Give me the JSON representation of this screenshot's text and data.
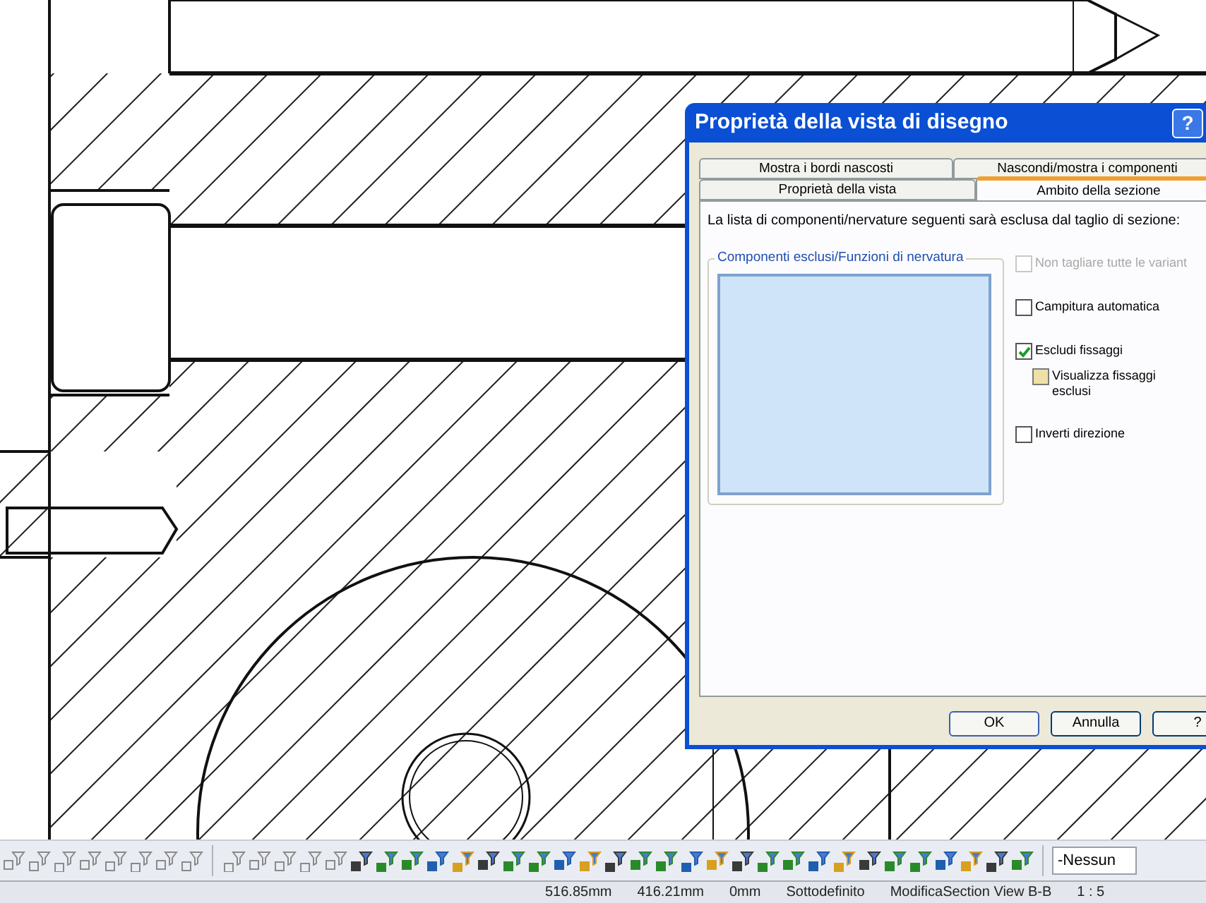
{
  "dialog": {
    "title": "Proprietà della vista di disegno",
    "help_button": "?",
    "tabs_back_row": [
      {
        "label": "Mostra i bordi nascosti",
        "selected": false
      },
      {
        "label": "Nascondi/mostra i componenti",
        "selected": false
      }
    ],
    "tabs_front_row": [
      {
        "label": "Proprietà della vista",
        "selected": false
      },
      {
        "label": "Ambito della sezione",
        "selected": true
      }
    ],
    "description": "La lista di componenti/nervature seguenti sarà esclusa dal taglio di sezione:",
    "group": {
      "title": "Componenti esclusi/Funzioni di nervatura"
    },
    "options": [
      {
        "label": "Non tagliare tutte le variant",
        "checked": false,
        "disabled": true
      },
      {
        "label": "Campitura automatica",
        "checked": false,
        "disabled": false
      },
      {
        "label": "Escludi fissaggi",
        "checked": true,
        "disabled": false,
        "children": [
          {
            "label": "Visualizza fissaggi esclusi",
            "checked": false,
            "disabled": false
          }
        ]
      },
      {
        "label": "Inverti direzione",
        "checked": false,
        "disabled": false
      }
    ],
    "buttons": [
      "OK",
      "Annulla",
      "?"
    ]
  },
  "toolbar": {
    "dropdown": "-Nessun"
  },
  "status_bar": [
    "516.85mm",
    "416.21mm",
    "0mm",
    "Sottodefinito",
    "ModificaSection View B-B",
    "1 : 5"
  ]
}
